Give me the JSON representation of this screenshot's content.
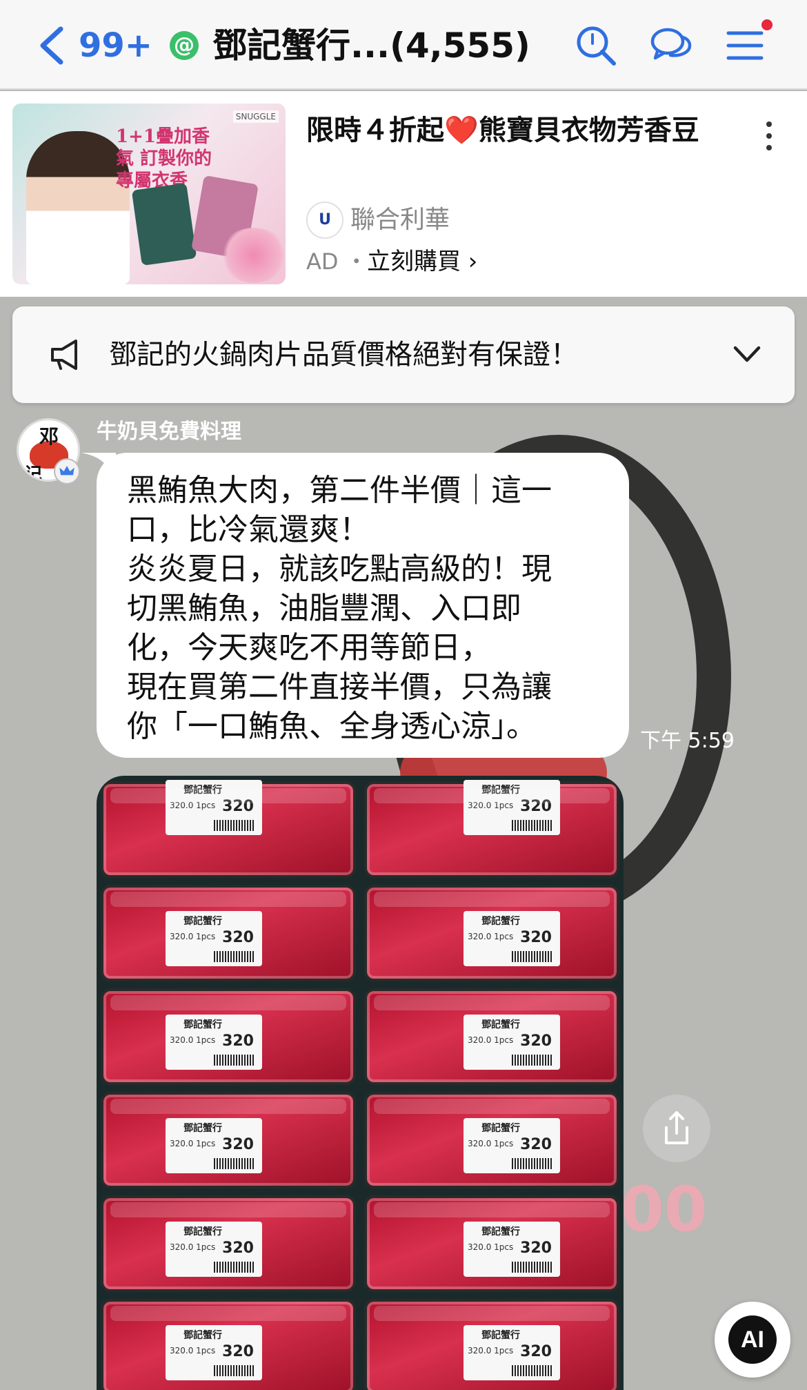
{
  "header": {
    "unread_count": "99+",
    "official_badge": "@",
    "title": "鄧記蟹行...(4,555)"
  },
  "ad": {
    "slogan": "1+1疊加香氣 訂製你的專屬衣香",
    "image_brand_tag": "SNUGGLE",
    "title_part1": "限時４折起",
    "heart": "❤️",
    "title_part2": "熊寶貝衣物芳香豆",
    "advertiser": "聯合利華",
    "advertiser_logo_text": "U",
    "label": "AD ・",
    "cta": "立刻購買 ›"
  },
  "announcement": {
    "text": "鄧記的火鍋肉片品質價格絕對有保證！"
  },
  "message": {
    "sender_name": "牛奶貝免費料理",
    "avatar_char1": "邓",
    "avatar_char2": "记",
    "text": "黑鮪魚大肉，第二件半價｜這一\n口，比冷氣還爽！\n炎炎夏日，就該吃點高級的！現\n切黑鮪魚，油脂豐潤、入口即\n化，今天爽吃不用等節日，\n現在買第二件直接半價，只為讓\n你「一口鮪魚、全身透心涼」。",
    "time": "下午 5:59"
  },
  "photo": {
    "store_label": "鄧記蟹行",
    "price": "320",
    "label_detail": "320.0 1pcs"
  },
  "background": {
    "deco_text": "00"
  },
  "buttons": {
    "ai_label": "AI"
  },
  "colors": {
    "accent_blue": "#2f6fe0",
    "official_green": "#3bbf6a",
    "notification_red": "#e8283b",
    "chat_background": "#b8b8b4"
  }
}
